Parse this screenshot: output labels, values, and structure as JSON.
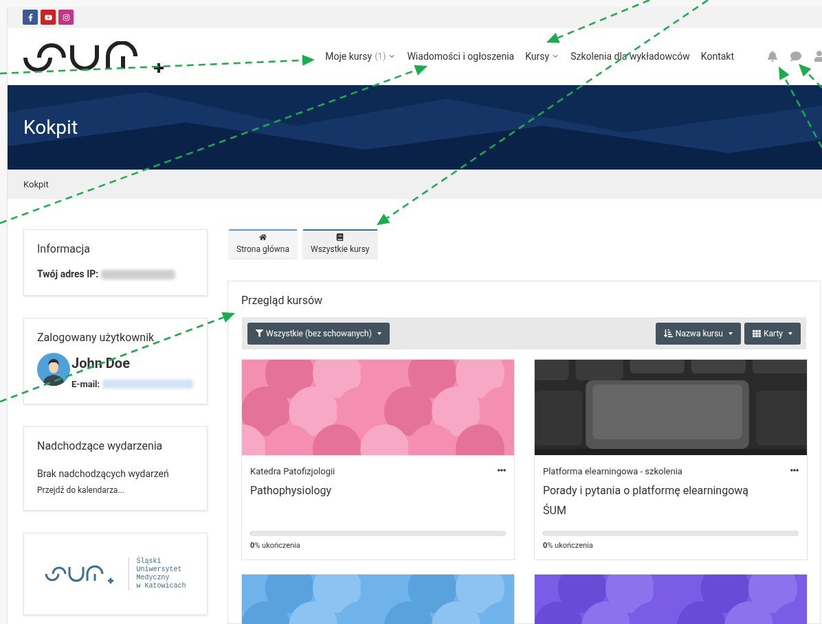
{
  "social_links": [
    {
      "kind": "facebook",
      "color": "#3b5998"
    },
    {
      "kind": "youtube",
      "color": "#d32121"
    },
    {
      "kind": "instagram",
      "color": "#c13584"
    }
  ],
  "nav": {
    "items": [
      {
        "label": "Moje kursy",
        "count": "(1)",
        "dropdown": true
      },
      {
        "label": "Wiadomości i ogłoszenia",
        "dropdown": false
      },
      {
        "label": "Kursy",
        "dropdown": true
      },
      {
        "label": "Szkolenia dla wykładowców",
        "dropdown": false
      },
      {
        "label": "Kontakt",
        "dropdown": false
      }
    ]
  },
  "banner": {
    "title": "Kokpit"
  },
  "breadcrumb": [
    "Kokpit"
  ],
  "sidebar": {
    "info": {
      "title": "Informacja",
      "ip_label": "Twój adres IP:"
    },
    "user": {
      "title": "Zalogowany użytkownik",
      "name": "John Doe",
      "email_label": "E-mail:"
    },
    "events": {
      "title": "Nadchodzące wydarzenia",
      "empty": "Brak nadchodzących wydarzeń",
      "link": "Przejdź do kalendarza..."
    },
    "logo_text": [
      "Śląski",
      "Uniwersytet",
      "Medyczny",
      "w Katowicach"
    ]
  },
  "tabs": [
    {
      "label": "Strona główna",
      "kind": "home",
      "selected": false
    },
    {
      "label": "Wszystkie kursy",
      "kind": "book",
      "selected": true
    }
  ],
  "overview": {
    "title": "Przegląd kursów",
    "filter": "Wszystkie (bez schowanych)",
    "sort": "Nazwa kursu",
    "view": "Karty",
    "courses": [
      {
        "kind": "pink",
        "category": "Katedra Patofizjologii",
        "name": "Pathophysiology",
        "level": 0,
        "progress": "**0**% ukończenia"
      },
      {
        "category": "Platforma elearningowa - szkolenia",
        "name": "Porady i pytania o platformę elearningową ŚUM",
        "level": 0,
        "progress": "**0**% ukończenia"
      },
      {
        "kind": "blue"
      },
      {
        "kind": "purple"
      }
    ]
  }
}
